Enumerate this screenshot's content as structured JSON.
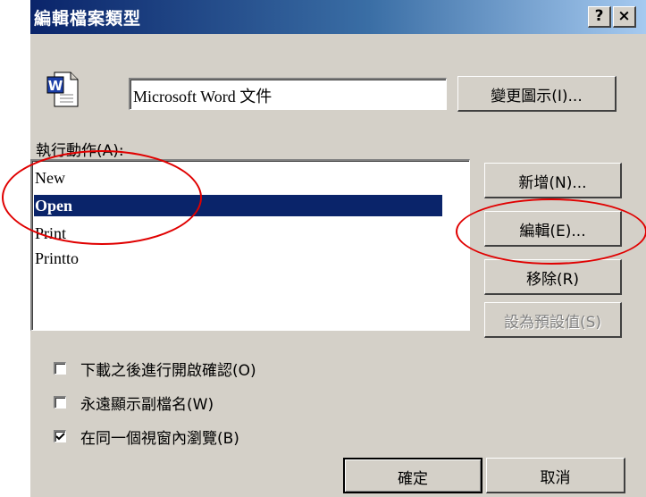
{
  "window": {
    "title": "編輯檔案類型",
    "help_label": "?",
    "close_label": "×"
  },
  "file_type": {
    "icon": "word-document-icon",
    "icon_letter": "W",
    "description": "Microsoft Word 文件",
    "change_icon_label": "變更圖示(I)..."
  },
  "actions": {
    "label": "執行動作(A):",
    "items": [
      {
        "label": "New",
        "selected": false
      },
      {
        "label": "Open",
        "selected": true
      },
      {
        "label": "Print",
        "selected": false
      },
      {
        "label": "Printto",
        "selected": false
      }
    ]
  },
  "action_buttons": {
    "new_label": "新增(N)...",
    "edit_label": "編輯(E)...",
    "remove_label": "移除(R)",
    "set_default_label": "設為預設值(S)"
  },
  "options": [
    {
      "label": "下載之後進行開啟確認(O)",
      "checked": false
    },
    {
      "label": "永遠顯示副檔名(W)",
      "checked": false
    },
    {
      "label": "在同一個視窗內瀏覽(B)",
      "checked": true
    }
  ],
  "footer": {
    "ok_label": "確定",
    "cancel_label": "取消"
  },
  "colors": {
    "annotation": "#e00000",
    "selection": "#0a246a",
    "titlebar": "#0a246a"
  }
}
